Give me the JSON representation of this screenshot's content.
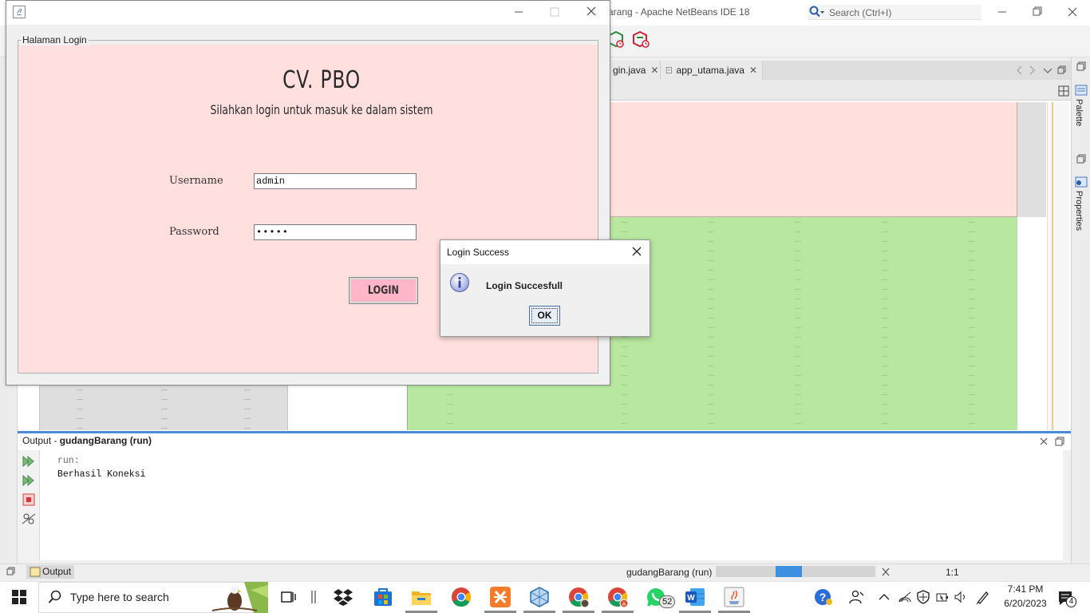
{
  "netbeans": {
    "window_title": "arang - Apache NetBeans IDE 18",
    "search_placeholder": "Search (Ctrl+I)",
    "tabs": [
      {
        "label": "gin.java"
      },
      {
        "label": "app_utama.java"
      }
    ],
    "right_panels": [
      "Palette",
      "Properties"
    ],
    "output": {
      "title_prefix": "Output - ",
      "title_project": "gudangBarang (run)",
      "lines": [
        "run:",
        "Berhasil Koneksi"
      ]
    },
    "status": {
      "output_tab": "Output",
      "project": "gudangBarang (run)",
      "position": "1:1",
      "progress": 0.45
    }
  },
  "login_window": {
    "panel_title": "Halaman Login",
    "company": "CV. PBO",
    "subtitle": "Silahkan login untuk masuk ke dalam sistem",
    "username_label": "Username",
    "username_value": "admin",
    "password_label": "Password",
    "password_value": "•••••",
    "login_button": "LOGIN"
  },
  "dialog": {
    "title": "Login Success",
    "message": "Login Succesfull",
    "ok_button": "OK"
  },
  "taskbar": {
    "search_placeholder": "Type here to search",
    "whatsapp_badge": "52",
    "notification_count": "4",
    "time": "7:41 PM",
    "date": "6/20/2023",
    "apps": [
      "task-view",
      "file-explorer-bar",
      "dropbox",
      "microsoft-store",
      "file-explorer",
      "chrome",
      "xampp",
      "virtualbox",
      "chrome-profile-1",
      "chrome-profile-2",
      "whatsapp",
      "word",
      "java"
    ]
  },
  "colors": {
    "login_panel_bg": "#ffe0de",
    "login_button_bg": "#ffb6c8",
    "design_green": "#b8e8a0",
    "output_accent": "#4a8bd8"
  }
}
